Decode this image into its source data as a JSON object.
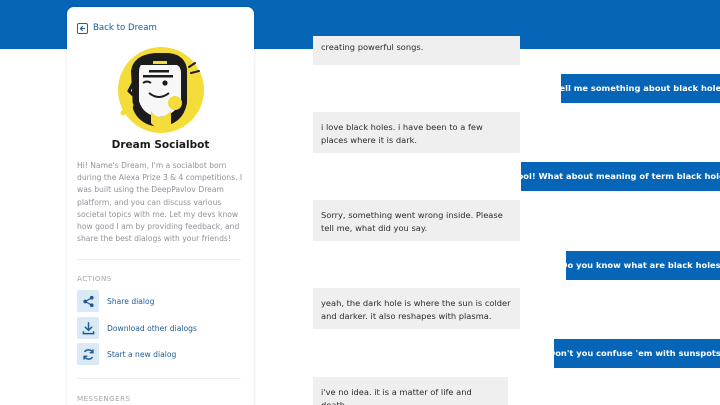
{
  "colors": {
    "primary": "#0665b7",
    "bot_bubble": "#efeff0"
  },
  "sidebar": {
    "back_label": "Back to Dream",
    "bot_name": "Dream Socialbot",
    "description": "Hi! Name's Dream, I'm a socialbot born during the Alexa Prize 3 & 4 competitions. I was built using the DeepPavlov Dream platform, and you can discuss various societal topics with me. Let my devs know how good I am by providing feedback, and share the best dialogs with your friends!",
    "actions_label": "ACTIONS",
    "actions": [
      {
        "label": "Share dialog",
        "icon": "share-icon"
      },
      {
        "label": "Download other dialogs",
        "icon": "download-icon"
      },
      {
        "label": "Start a new dialog",
        "icon": "refresh-icon"
      }
    ],
    "messengers_label": "MESSENGERS"
  },
  "chat": {
    "messages": [
      {
        "from": "bot",
        "text": "creating powerful songs."
      },
      {
        "from": "user",
        "text": "Tell me something about black holes"
      },
      {
        "from": "bot",
        "text": "i love black holes. i have been to a few places where it is dark."
      },
      {
        "from": "user",
        "text": "Cool! What about meaning of term black holes"
      },
      {
        "from": "bot",
        "text": "Sorry, something went wrong inside. Please tell me, what did you say."
      },
      {
        "from": "user",
        "text": "Do you know what are black holes?"
      },
      {
        "from": "bot",
        "text": "yeah, the dark hole is where the sun is colder and darker. it also reshapes with plasma."
      },
      {
        "from": "user",
        "text": "Don't you confuse 'em with sunspots?"
      },
      {
        "from": "bot",
        "text": "i've no idea. it is a matter of life and death."
      }
    ]
  }
}
